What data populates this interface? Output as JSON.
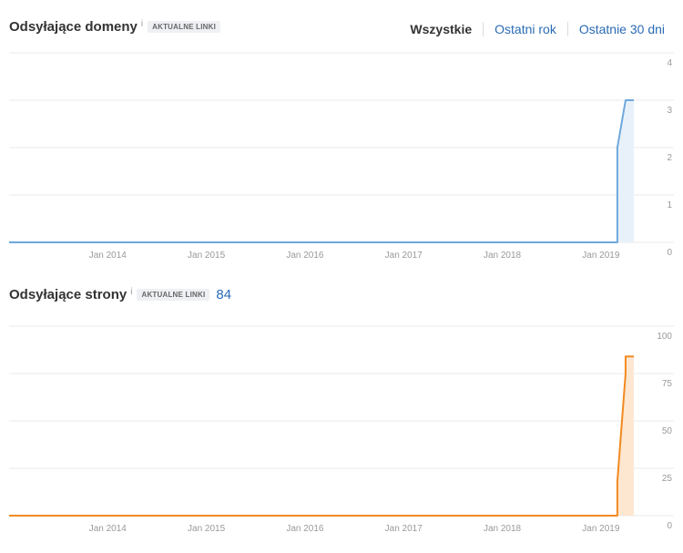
{
  "filters": {
    "all": "Wszystkie",
    "last_year": "Ostatni rok",
    "last_30_days": "Ostatnie 30 dni"
  },
  "colors": {
    "domains": "#6fa8dc",
    "domains_fill": "#e8f1fa",
    "pages": "#f28a21",
    "pages_fill": "#fde7d1"
  },
  "chart_data": [
    {
      "type": "line",
      "title": "Odsyłające domeny",
      "info": "i",
      "badge": "AKTUALNE LINKI",
      "x_ticks": [
        "Jan 2014",
        "Jan 2015",
        "Jan 2016",
        "Jan 2017",
        "Jan 2018",
        "Jan 2019"
      ],
      "y_ticks": [
        4,
        3,
        2,
        1,
        0
      ],
      "ylim": [
        0,
        4
      ],
      "xlim": [
        "2013-01",
        "2019-06"
      ],
      "grid": true,
      "series": [
        {
          "x": [
            "2013-01",
            "2019-03",
            "2019-03",
            "2019-04",
            "2019-05"
          ],
          "y": [
            0,
            0,
            2,
            3,
            3
          ]
        }
      ]
    },
    {
      "type": "line",
      "title": "Odsyłające strony",
      "info": "i",
      "badge": "AKTUALNE LINKI",
      "count": "84",
      "x_ticks": [
        "Jan 2014",
        "Jan 2015",
        "Jan 2016",
        "Jan 2017",
        "Jan 2018",
        "Jan 2019"
      ],
      "y_ticks": [
        100,
        75,
        50,
        25,
        0
      ],
      "ylim": [
        0,
        100
      ],
      "xlim": [
        "2013-01",
        "2019-06"
      ],
      "grid": true,
      "series": [
        {
          "x": [
            "2013-01",
            "2019-03",
            "2019-03",
            "2019-04",
            "2019-04",
            "2019-05"
          ],
          "y": [
            0,
            0,
            18,
            75,
            84,
            84
          ]
        }
      ]
    }
  ]
}
